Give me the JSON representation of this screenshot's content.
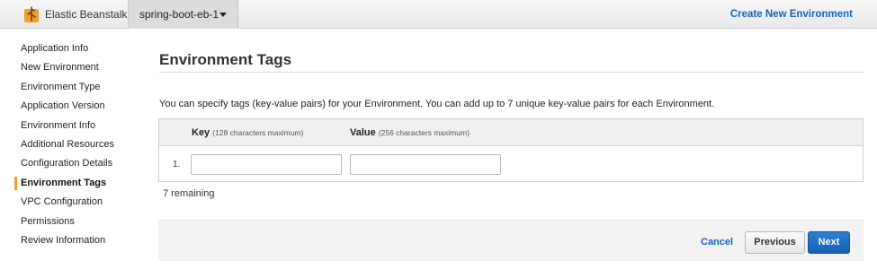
{
  "topbar": {
    "brand_label": "Elastic Beanstalk",
    "brand_icon": "elastic-beanstalk-logo",
    "app_dropdown": "spring-boot-eb-1",
    "create_link": "Create New Environment"
  },
  "sidebar": {
    "items": [
      {
        "label": "Application Info"
      },
      {
        "label": "New Environment"
      },
      {
        "label": "Environment Type"
      },
      {
        "label": "Application Version"
      },
      {
        "label": "Environment Info"
      },
      {
        "label": "Additional Resources"
      },
      {
        "label": "Configuration Details"
      },
      {
        "label": "Environment Tags",
        "active": true
      },
      {
        "label": "VPC Configuration"
      },
      {
        "label": "Permissions"
      },
      {
        "label": "Review Information"
      }
    ]
  },
  "main": {
    "title": "Environment Tags",
    "description": "You can specify tags (key-value pairs) for your Environment. You can add up to 7 unique key-value pairs for each Environment.",
    "table": {
      "key_header": "Key",
      "key_note": "(128 characters maximum)",
      "value_header": "Value",
      "value_note": "(256 characters maximum)",
      "rows": [
        {
          "number": "1.",
          "key": "",
          "value": ""
        }
      ]
    },
    "remaining": "7 remaining"
  },
  "footer": {
    "cancel_label": "Cancel",
    "previous_label": "Previous",
    "next_label": "Next"
  },
  "colors": {
    "accent": "#f29d2a",
    "link": "#1166bb",
    "primary_button": "#1a6bc4"
  }
}
